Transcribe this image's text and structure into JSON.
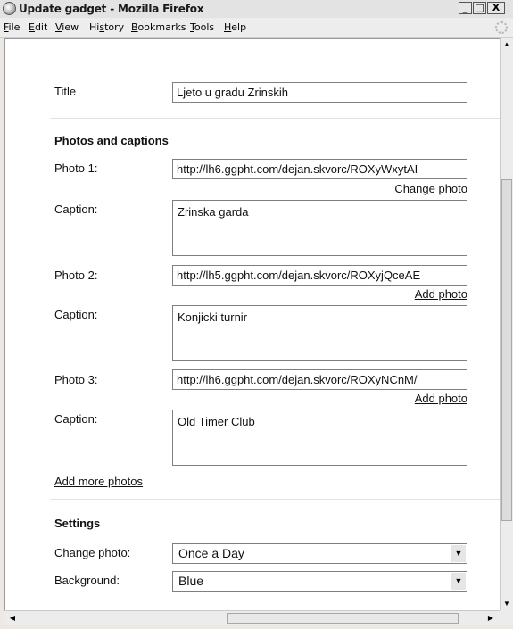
{
  "window": {
    "title": "Update gadget - Mozilla Firefox",
    "controls": {
      "minimize": "_",
      "maximize": "□",
      "close": "X"
    }
  },
  "menu": [
    "File",
    "Edit",
    "View",
    "History",
    "Bookmarks",
    "Tools",
    "Help"
  ],
  "menu_access_keys": [
    "F",
    "E",
    "V",
    "s",
    "B",
    "T",
    "H"
  ],
  "form": {
    "title_label": "Title",
    "title_value": "Ljeto u gradu Zrinskih",
    "photos_section": "Photos and captions",
    "photos": [
      {
        "label": "Photo 1:",
        "url": "http://lh6.ggpht.com/dejan.skvorc/ROXyWxytAI",
        "link": "Change photo",
        "caption_label": "Caption:",
        "caption": "Zrinska garda"
      },
      {
        "label": "Photo 2:",
        "url": "http://lh5.ggpht.com/dejan.skvorc/ROXyjQceAE",
        "link": "Add photo",
        "caption_label": "Caption:",
        "caption": "Konjicki turnir"
      },
      {
        "label": "Photo 3:",
        "url": "http://lh6.ggpht.com/dejan.skvorc/ROXyNCnM/",
        "link": "Add photo",
        "caption_label": "Caption:",
        "caption": "Old Timer Club"
      }
    ],
    "add_more": "Add more photos",
    "settings_section": "Settings",
    "change_photo_label": "Change photo:",
    "change_photo_value": "Once a Day",
    "background_label": "Background:",
    "background_value": "Blue"
  },
  "icons": {
    "app": "firefox-icon",
    "throbber": "throbber-icon"
  }
}
